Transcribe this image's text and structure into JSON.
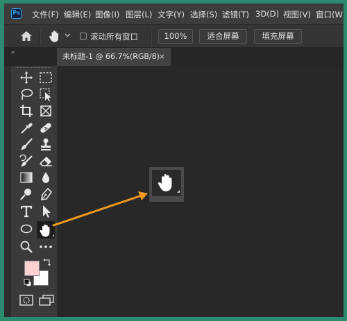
{
  "app": {
    "logo": "Ps",
    "accent_color": "#31a8ff"
  },
  "menu": {
    "items": [
      "文件(F)",
      "编辑(E)",
      "图像(I)",
      "图层(L)",
      "文字(Y)",
      "选择(S)",
      "滤镜(T)",
      "3D(D)",
      "视图(V)",
      "窗口(W"
    ]
  },
  "options_bar": {
    "home_icon": "home-icon",
    "tool_icon": "hand-icon",
    "scroll_all_windows_label": "滚动所有窗口",
    "scroll_all_windows_checked": false,
    "zoom_100_label": "100%",
    "fit_screen_label": "适合屏幕",
    "fill_screen_label": "填充屏幕"
  },
  "tabs": {
    "collapse_glyph": "«",
    "document_title": "未标题-1 @ 66.7%(RGB/8)",
    "close_glyph": "×"
  },
  "toolbar": {
    "tools": [
      "move-icon",
      "marquee-icon",
      "lasso-icon",
      "object-select-icon",
      "crop-icon",
      "frame-icon",
      "eyedropper-icon",
      "healing-icon",
      "brush-icon",
      "stamp-icon",
      "history-brush-icon",
      "eraser-icon",
      "gradient-icon",
      "blur-icon",
      "dodge-icon",
      "pen-icon",
      "type-icon",
      "path-select-icon",
      "ellipse-icon",
      "hand-icon",
      "zoom-icon",
      "more-icon"
    ],
    "active_tool": "hand-icon",
    "foreground_color": "#ffd0d0",
    "background_color": "#ffffff"
  },
  "annotation": {
    "callout_icon": "hand-icon",
    "arrow_color": "#f29a1e"
  }
}
